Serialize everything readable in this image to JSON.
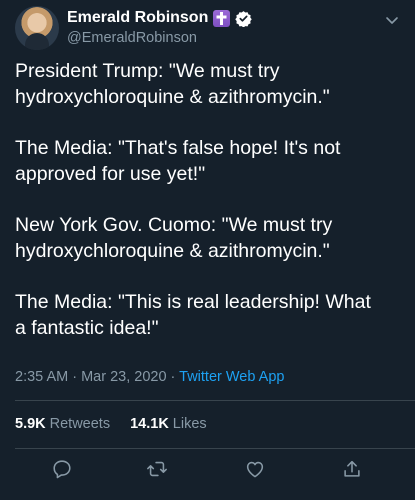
{
  "tweet": {
    "author": {
      "name": "Emerald Robinson",
      "handle": "@EmeraldRobinson",
      "verified": true,
      "badge_icon": "latin-cross-icon"
    },
    "paragraphs": [
      "President Trump: \"We must try\nhydroxychloroquine & azithromycin.\"",
      "The Media: \"That's false hope! It's not\napproved for use yet!\"",
      "New York Gov. Cuomo: \"We must try\nhydroxychloroquine & azithromycin.\"",
      "The Media: \"This is real leadership! What\na fantastic idea!\""
    ],
    "timestamp": "2:35 AM · Mar 23, 2020 · ",
    "source": "Twitter Web App",
    "retweets_count": "5.9K",
    "retweets_label": "Retweets",
    "likes_count": "14.1K",
    "likes_label": "Likes"
  },
  "colors": {
    "background": "#15202b",
    "secondary_text": "#8899a6",
    "accent": "#1da1f2",
    "divider": "#38444d",
    "badge": "#8e5bd0"
  },
  "actions": [
    "reply-icon",
    "retweet-icon",
    "like-icon",
    "share-icon"
  ]
}
